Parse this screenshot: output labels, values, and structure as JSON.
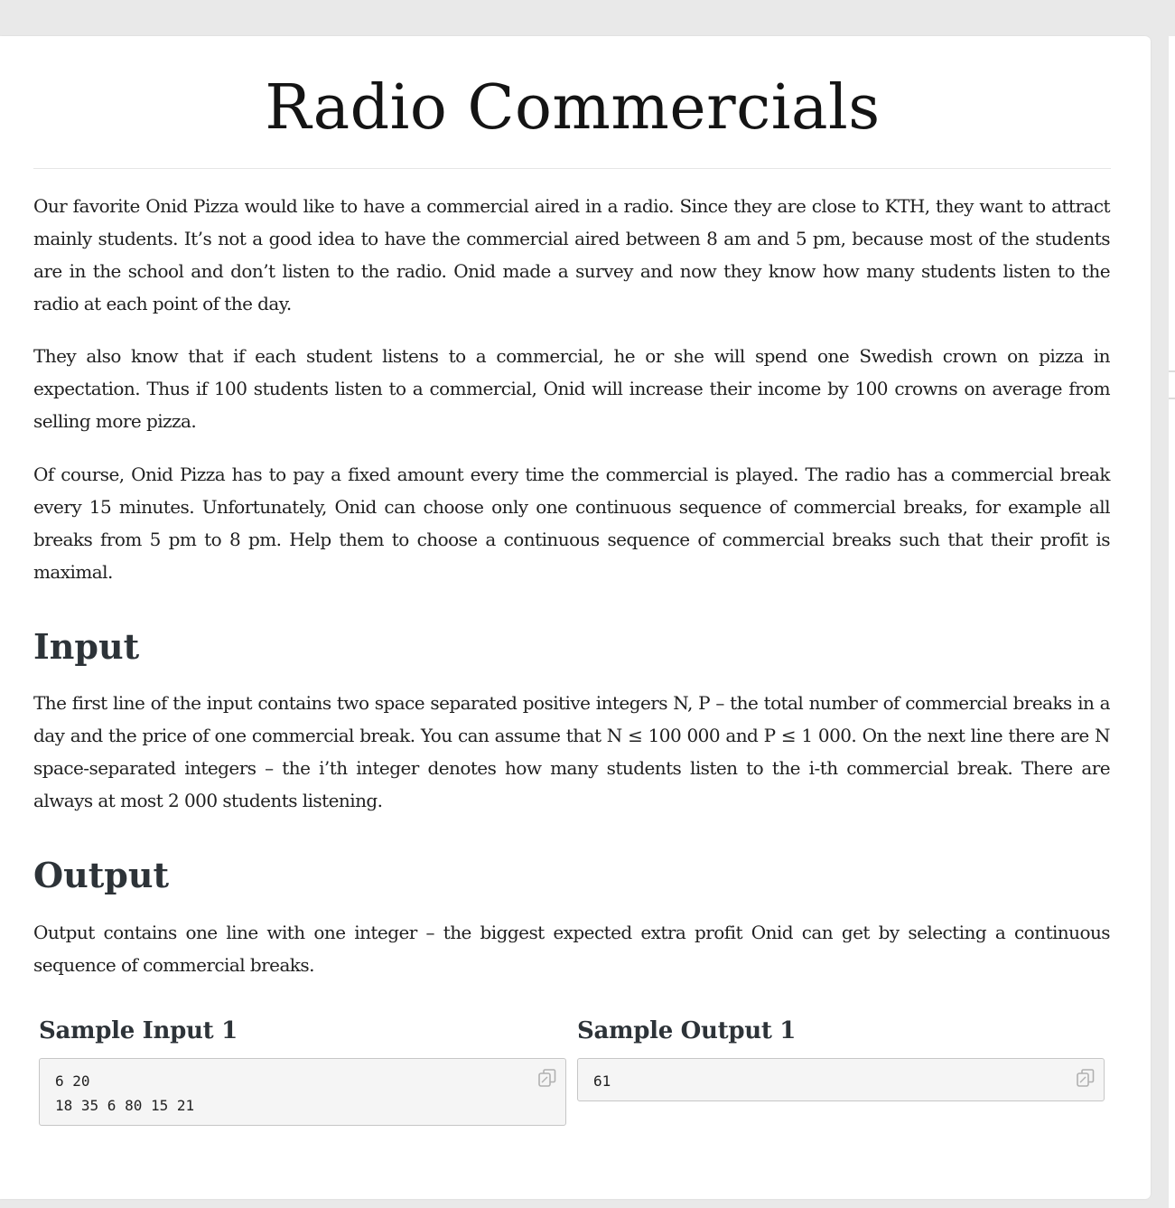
{
  "problem": {
    "title": "Radio Commercials",
    "paragraphs": [
      "Our favorite Onid Pizza would like to have a commercial aired in a radio. Since they are close to KTH, they want to attract mainly students. It’s not a good idea to have the commercial aired between 8 am and 5 pm, because most of the students are in the school and don’t listen to the radio. Onid made a survey and now they know how many students listen to the radio at each point of the day.",
      "They also know that if each student listens to a commercial, he or she will spend one Swedish crown on pizza in expectation. Thus if 100 students listen to a commercial, Onid will increase their income by 100 crowns on average from selling more pizza.",
      "Of course, Onid Pizza has to pay a fixed amount every time the commercial is played. The radio has a commercial break every 15 minutes. Unfortunately, Onid can choose only one continuous sequence of commercial breaks, for example all breaks from 5 pm to 8 pm. Help them to choose a continuous sequence of commercial breaks such that their profit is maximal."
    ],
    "input_heading": "Input",
    "input_text": "The first line of the input contains two space separated positive integers N, P – the total number of commercial breaks in a day and the price of one commercial break. You can assume that N ≤ 100 000 and P ≤ 1 000. On the next line there are N space-separated integers – the i’th integer denotes how many students listen to the i-th commercial break. There are always at most 2 000 students listening.",
    "output_heading": "Output",
    "output_text": "Output contains one line with one integer – the biggest expected extra profit Onid can get by selecting a continuous sequence of commercial breaks."
  },
  "samples": {
    "input_label": "Sample Input 1",
    "input_value": "6 20\n18 35 6 80 15 21",
    "output_label": "Sample Output 1",
    "output_value": "61",
    "copy_icon": "copy-icon"
  }
}
